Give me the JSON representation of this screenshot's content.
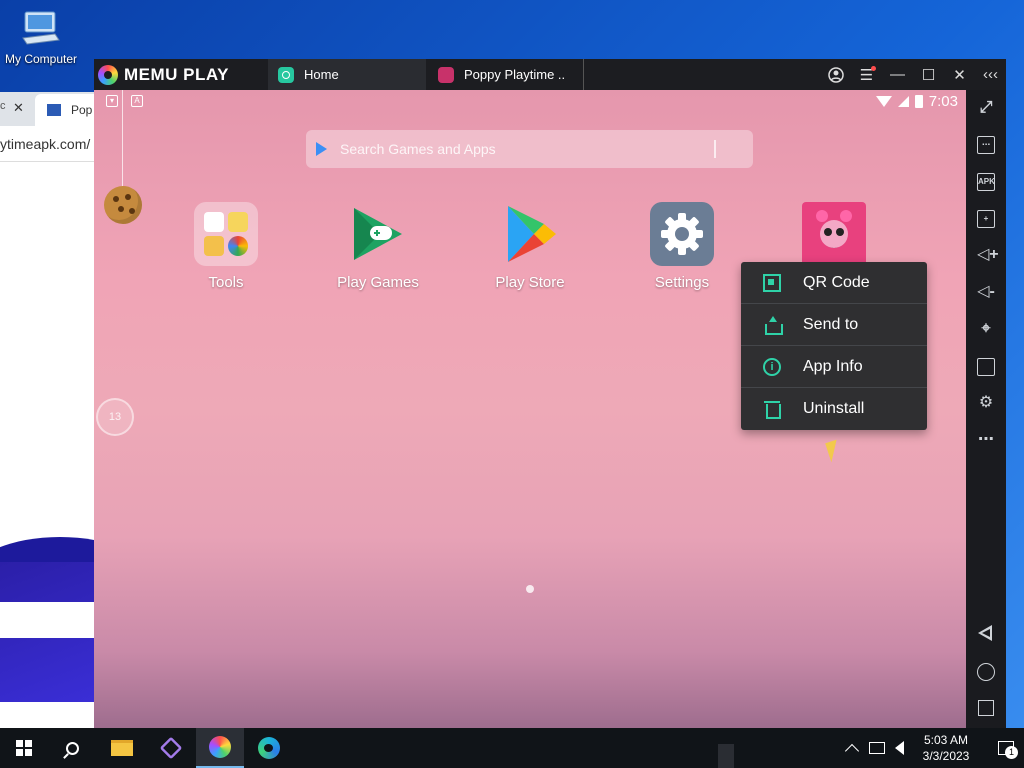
{
  "desktop": {
    "icons": [
      {
        "label": "My Computer",
        "icon": "computer-icon"
      }
    ]
  },
  "browser": {
    "tab_active_label": "Pop",
    "tab_prev_label": "c",
    "address_text": "ytimeapk.com/"
  },
  "memu": {
    "brand": "MEMU PLAY",
    "tabs": [
      {
        "label": "Home",
        "icon": "home-icon"
      },
      {
        "label": "Poppy Playtime ..",
        "icon": "poppy-app-icon"
      }
    ],
    "window_controls": [
      "account-icon",
      "menu-icon",
      "minimize-icon",
      "maximize-icon",
      "close-icon",
      "collapse-sidebar-icon"
    ]
  },
  "android": {
    "status_time": "7:03",
    "search_placeholder": "Search Games and Apps",
    "bubble_text": "13",
    "apps": [
      {
        "label": "Tools",
        "icon": "tools-folder-icon"
      },
      {
        "label": "Play Games",
        "icon": "play-games-icon"
      },
      {
        "label": "Play Store",
        "icon": "play-store-icon"
      },
      {
        "label": "Settings",
        "icon": "settings-gear-icon"
      },
      {
        "label": "",
        "icon": "poppy-playtime-icon"
      }
    ],
    "context_menu": [
      {
        "label": "QR Code",
        "icon": "qr-code-icon"
      },
      {
        "label": "Send to",
        "icon": "share-icon"
      },
      {
        "label": "App Info",
        "icon": "info-icon"
      },
      {
        "label": "Uninstall",
        "icon": "trash-icon"
      }
    ],
    "accent_color": "#2fd2a8"
  },
  "sidebar": {
    "apk_label": "APK",
    "tools": [
      "fullscreen-icon",
      "keyboard-icon",
      "apk-install-icon",
      "multi-instance-icon",
      "volume-up-icon",
      "volume-down-icon",
      "location-icon",
      "folder-icon",
      "settings-icon",
      "more-icon",
      "back-icon",
      "home-circle-icon",
      "recents-icon"
    ]
  },
  "taskbar": {
    "time": "5:03 AM",
    "date": "3/3/2023",
    "notification_count": "1"
  }
}
